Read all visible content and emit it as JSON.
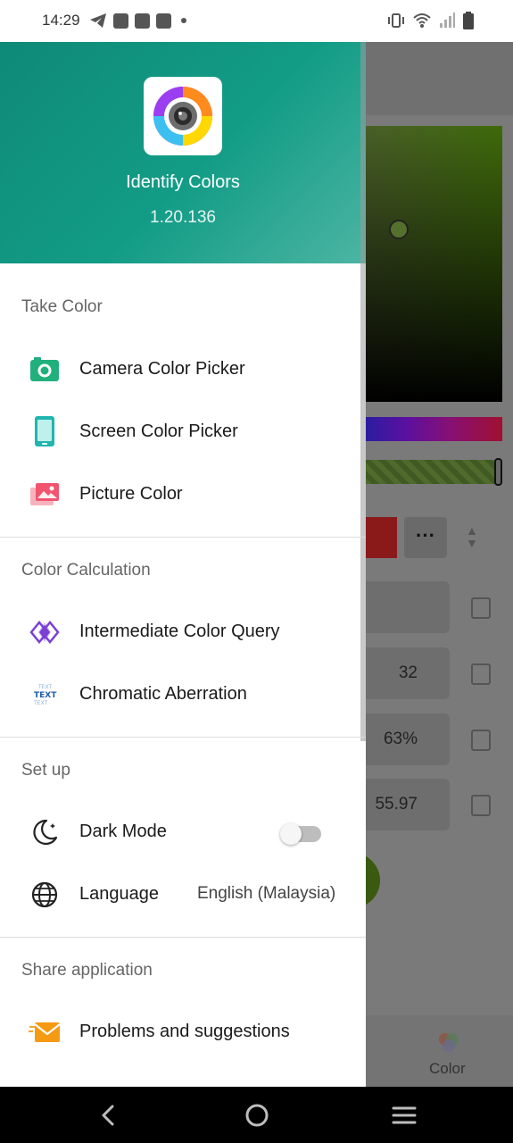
{
  "status_bar": {
    "time": "14:29",
    "icons": [
      "telegram-icon",
      "shopping-bag-icon",
      "shopping-bag-icon",
      "shopping-bag-icon",
      "dot-icon",
      "vibrate-icon",
      "wifi-icon",
      "signal-icon",
      "battery-icon"
    ]
  },
  "drawer": {
    "app_name": "Identify Colors",
    "version": "1.20.136",
    "sections": {
      "take_color": {
        "title": "Take Color",
        "items": [
          {
            "label": "Camera Color Picker",
            "icon": "camera-icon"
          },
          {
            "label": "Screen Color Picker",
            "icon": "phone-screen-icon"
          },
          {
            "label": "Picture Color",
            "icon": "picture-icon"
          }
        ]
      },
      "color_calculation": {
        "title": "Color Calculation",
        "items": [
          {
            "label": "Intermediate Color Query",
            "icon": "diamond-icon"
          },
          {
            "label": "Chromatic Aberration",
            "icon": "text-aberration-icon"
          }
        ]
      },
      "set_up": {
        "title": "Set up",
        "dark_mode": {
          "label": "Dark Mode",
          "enabled": false
        },
        "language": {
          "label": "Language",
          "value": "English (Malaysia)"
        }
      },
      "share": {
        "title": "Share application",
        "items": [
          {
            "label": "Problems and suggestions",
            "icon": "mail-icon"
          }
        ]
      }
    }
  },
  "background": {
    "field_values": [
      "",
      "32",
      "63%",
      "55.97"
    ],
    "more_label": "···",
    "color_tab": "Color"
  },
  "colors": {
    "header_start": "#0f8a78",
    "header_end": "#4cb5a3",
    "accent_green": "#21b07c"
  }
}
